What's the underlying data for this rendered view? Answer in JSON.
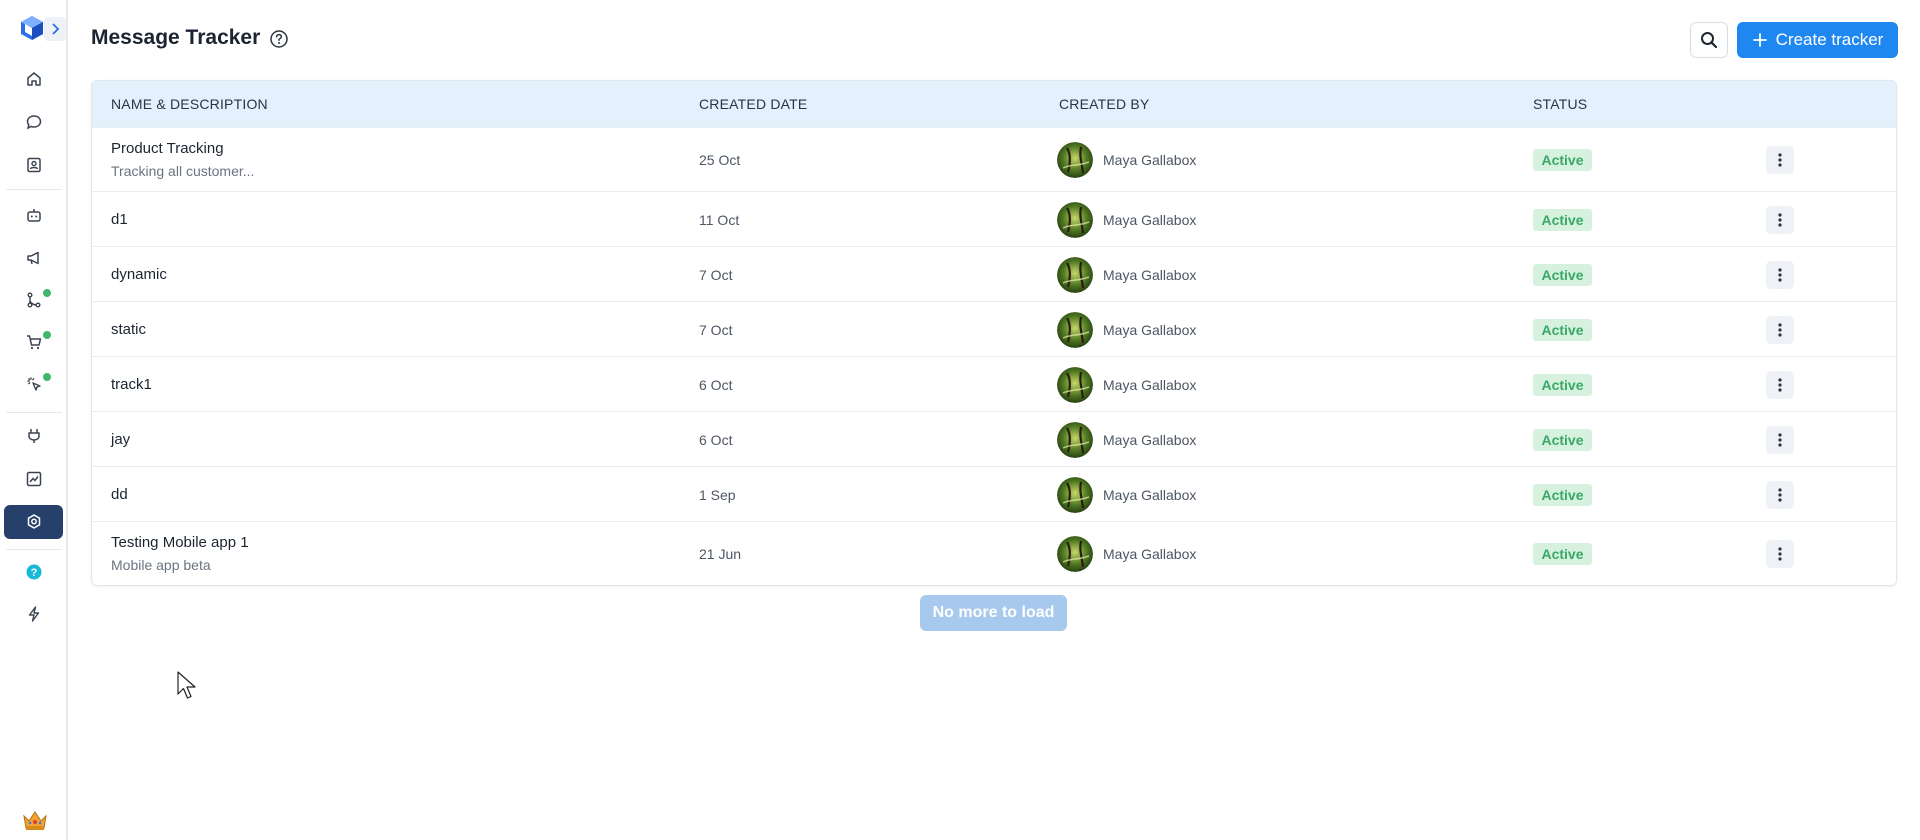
{
  "header": {
    "title": "Message Tracker",
    "create_label": "Create tracker"
  },
  "sidebar": {
    "items": [
      {
        "icon": "home-icon"
      },
      {
        "icon": "chat-icon"
      },
      {
        "icon": "contacts-icon"
      },
      {
        "icon": "bot-icon"
      },
      {
        "icon": "megaphone-icon"
      },
      {
        "icon": "flow-icon",
        "dot": true
      },
      {
        "icon": "cart-icon",
        "dot": true
      },
      {
        "icon": "click-icon",
        "dot": true
      },
      {
        "icon": "plug-icon"
      },
      {
        "icon": "analytics-icon"
      },
      {
        "icon": "settings-icon",
        "active": true
      },
      {
        "icon": "help-icon"
      },
      {
        "icon": "bolt-icon"
      }
    ]
  },
  "table": {
    "columns": [
      "NAME & DESCRIPTION",
      "CREATED DATE",
      "CREATED BY",
      "STATUS"
    ],
    "rows": [
      {
        "name": "Product Tracking",
        "description": "Tracking all customer...",
        "date": "25 Oct",
        "created_by": "Maya Gallabox",
        "status": "Active"
      },
      {
        "name": "d1",
        "description": "",
        "date": "11 Oct",
        "created_by": "Maya Gallabox",
        "status": "Active"
      },
      {
        "name": "dynamic",
        "description": "",
        "date": "7 Oct",
        "created_by": "Maya Gallabox",
        "status": "Active"
      },
      {
        "name": "static",
        "description": "",
        "date": "7 Oct",
        "created_by": "Maya Gallabox",
        "status": "Active"
      },
      {
        "name": "track1",
        "description": "",
        "date": "6 Oct",
        "created_by": "Maya Gallabox",
        "status": "Active"
      },
      {
        "name": "jay",
        "description": "",
        "date": "6 Oct",
        "created_by": "Maya Gallabox",
        "status": "Active"
      },
      {
        "name": "dd",
        "description": "",
        "date": "1 Sep",
        "created_by": "Maya Gallabox",
        "status": "Active"
      },
      {
        "name": "Testing Mobile app 1",
        "description": "Mobile app beta",
        "date": "21 Jun",
        "created_by": "Maya Gallabox",
        "status": "Active"
      }
    ]
  },
  "load_more_label": "No more to load",
  "colors": {
    "accent": "#1f87f0",
    "header_bg": "#e4f0fc",
    "active_badge_bg": "#d6f2df",
    "active_badge_text": "#39a866",
    "sidebar_active": "#26406b",
    "notification_dot": "#3fb86b"
  }
}
